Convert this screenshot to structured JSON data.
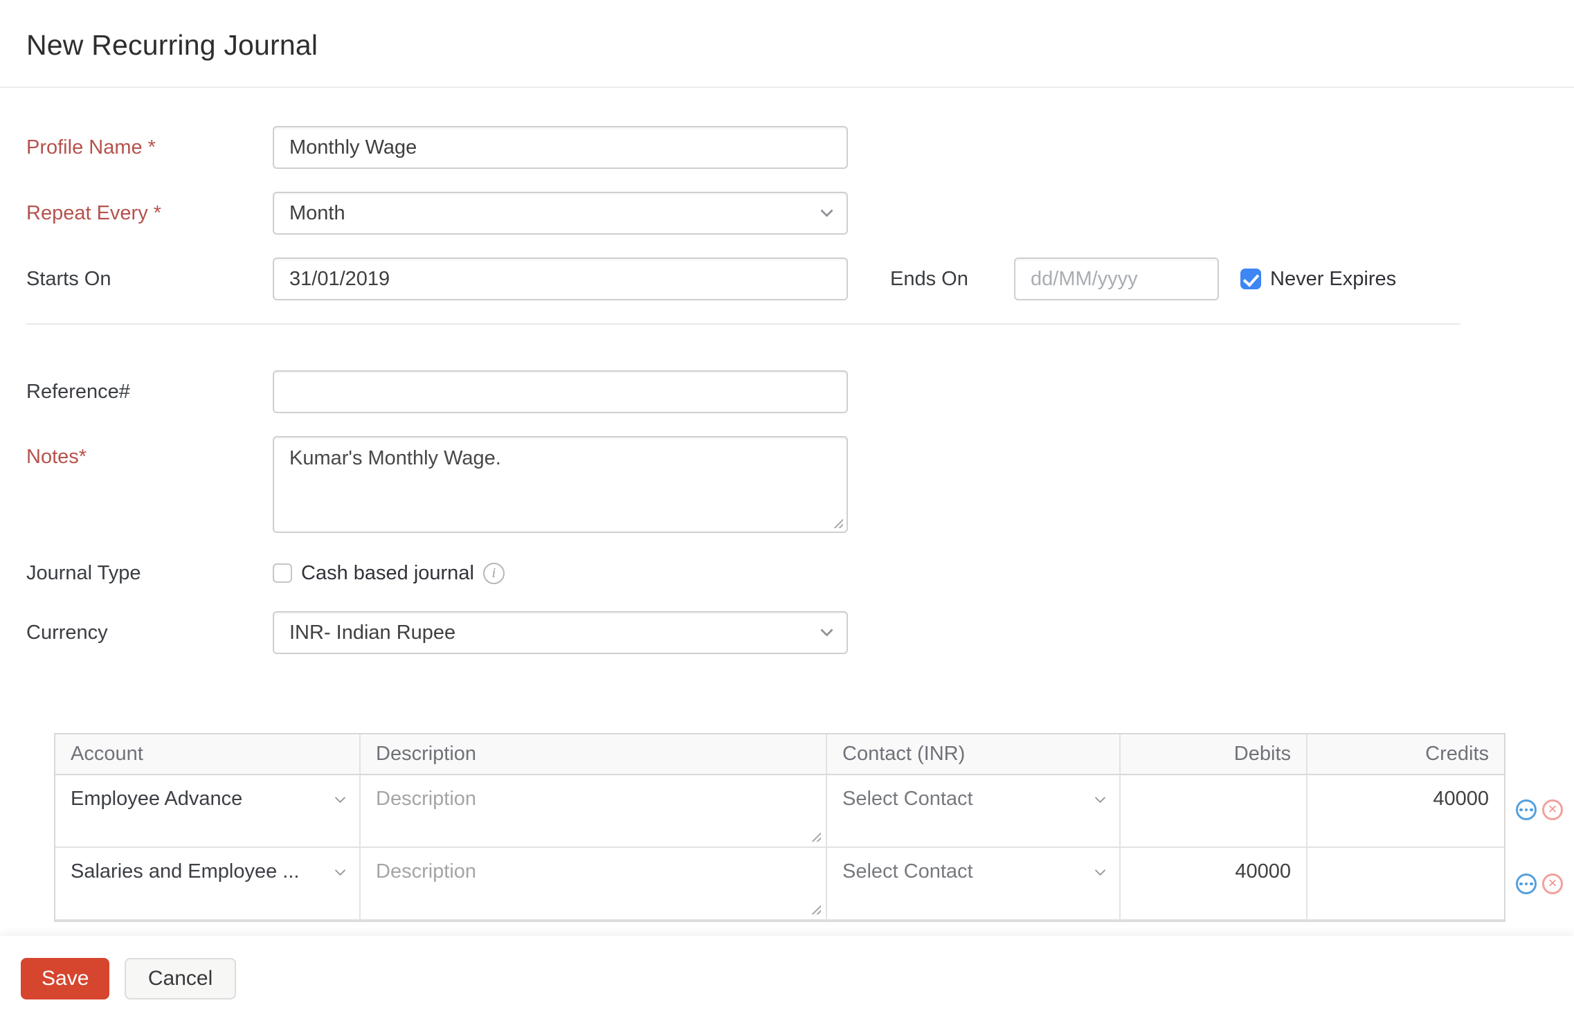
{
  "page": {
    "title": "New Recurring Journal"
  },
  "form": {
    "profile_name": {
      "label": "Profile Name *",
      "value": "Monthly Wage"
    },
    "repeat_every": {
      "label": "Repeat Every *",
      "value": "Month"
    },
    "starts_on": {
      "label": "Starts On",
      "value": "31/01/2019"
    },
    "ends_on": {
      "label": "Ends On",
      "placeholder": "dd/MM/yyyy"
    },
    "never_expires": {
      "label": "Never Expires",
      "checked": true
    },
    "reference": {
      "label": "Reference#",
      "value": ""
    },
    "notes": {
      "label": "Notes*",
      "value": "Kumar's Monthly Wage."
    },
    "journal_type": {
      "label": "Journal Type",
      "checkbox_label": "Cash based journal",
      "checked": false
    },
    "currency": {
      "label": "Currency",
      "value": "INR- Indian Rupee"
    }
  },
  "table": {
    "headers": [
      "Account",
      "Description",
      "Contact (INR)",
      "Debits",
      "Credits"
    ],
    "rows": [
      {
        "account": "Employee Advance",
        "description_placeholder": "Description",
        "contact_placeholder": "Select Contact",
        "debits": "",
        "credits": "40000"
      },
      {
        "account": "Salaries and Employee ...",
        "description_placeholder": "Description",
        "contact_placeholder": "Select Contact",
        "debits": "40000",
        "credits": ""
      }
    ]
  },
  "footer": {
    "save": "Save",
    "cancel": "Cancel"
  },
  "icons": {
    "delete": "×",
    "info": "i"
  },
  "colors": {
    "required_label": "#b5524c",
    "save_button": "#d6452e",
    "checkbox_checked": "#3d86f4",
    "action_blue": "#55a0dc",
    "action_red": "#f1a19e"
  }
}
